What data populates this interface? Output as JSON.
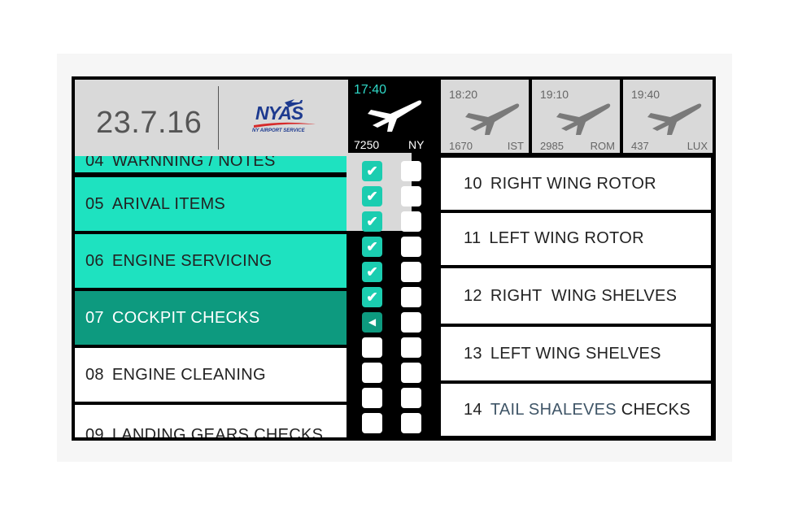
{
  "header": {
    "date": "23.7.16",
    "logo": {
      "name": "NYAS",
      "subtitle": "NY AIRPORT SERVICE"
    }
  },
  "current_flight": {
    "time": "17:40",
    "number": "7250",
    "destination": "NY",
    "icon": "plane-icon"
  },
  "upcoming_flights": [
    {
      "time": "18:20",
      "number": "1670",
      "destination": "IST",
      "icon": "plane-icon"
    },
    {
      "time": "19:10",
      "number": "2985",
      "destination": "ROM",
      "icon": "plane-icon"
    },
    {
      "time": "19:40",
      "number": "437",
      "destination": "LUX",
      "icon": "plane-icon"
    }
  ],
  "sections": [
    {
      "num": "04",
      "label": "WARNNING / NOTES",
      "state": "done"
    },
    {
      "num": "05",
      "label": "ARIVAL ITEMS",
      "state": "done"
    },
    {
      "num": "06",
      "label": "ENGINE SERVICING",
      "state": "done"
    },
    {
      "num": "07",
      "label": "COCKPIT CHECKS",
      "state": "active"
    },
    {
      "num": "08",
      "label": "ENGINE CLEANING",
      "state": "pending"
    },
    {
      "num": "09",
      "label": "LANDING GEARS CHECKS",
      "state": "pending"
    }
  ],
  "checklist": {
    "left_column": [
      "done",
      "done",
      "done",
      "done",
      "done",
      "done",
      "current",
      "empty",
      "empty",
      "empty",
      "empty"
    ],
    "right_column": [
      "empty",
      "empty",
      "empty",
      "empty",
      "empty",
      "empty",
      "empty",
      "empty",
      "empty",
      "empty",
      "empty"
    ],
    "done_glyph": "✔",
    "current_glyph": "◀"
  },
  "tasks": [
    {
      "num": "10",
      "label": "RIGHT WING ROTOR"
    },
    {
      "num": "11",
      "label": "LEFT WING ROTOR"
    },
    {
      "num": "12",
      "label": "RIGHT  WING SHELVES"
    },
    {
      "num": "13",
      "label": "LEFT WING SHELVES"
    },
    {
      "num": "14",
      "label_highlight": "TAIL SHALEVES",
      "label_rest": " CHECKS"
    }
  ],
  "colors": {
    "mint": "#1ee2c0",
    "active": "#0d9a7f",
    "check_done": "#1bcdb0",
    "time_accent": "#2fd9c8",
    "logo_blue": "#1d3a8f"
  }
}
